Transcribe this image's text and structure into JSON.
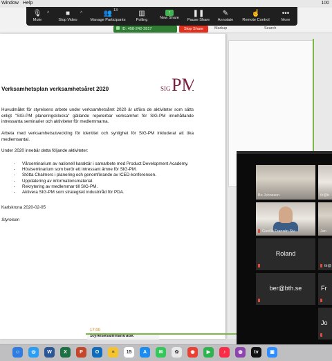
{
  "menubar": {
    "item_window": "Window",
    "item_help": "Help",
    "battery": "100"
  },
  "toolbar": {
    "mute": "Mute",
    "stop_video": "Stop Video",
    "manage_participants": "Manage Participants",
    "participant_count": "13",
    "polling": "Polling",
    "new_share": "New Share",
    "pause_share": "Pause Share",
    "annotate": "Annotate",
    "remote_control": "Remote Control",
    "more": "More"
  },
  "meeting": {
    "id_label": "ID: 458-242-2817",
    "stop_share": "Stop Share"
  },
  "app_labels": {
    "markup": "Markup",
    "search": "Search"
  },
  "document": {
    "logo_text": "SIG",
    "logo_letters": "PM",
    "title": "Verksamhetsplan verksamhetsåret 2020",
    "para1": "Huvudmålet för styrelsens arbete under verksamhetsåret 2020 är utföra de aktiviteter som sätts enligt \"SIG-PM planeringsklocka\" gällande repeterbar verksamhet för SIG-PM innehållande intressanta seminarier och aktiviteter för medlemmarna.",
    "para2": "Arbeta med verksamhetsutveckling för identitet och synlighet för SIG-PM inkluderat att öka medlemsantal.",
    "para3": "Under 2020 innebär detta följande aktiviteter:",
    "bullets": [
      "Vårseminarium av nationell karaktär i samarbete med Product Development Academy.",
      "Höstseminarium som berör ett intressant ämne för SIG-PM.",
      "Stötta Chalmers i planering och genomförande av ICED-konferensen.",
      "Uppdatering av informationsmaterial.",
      "Rekrytering av medlemmar till SIG-PM.",
      "Aktivera SIG-PM som strategiskt industriråd för PDA."
    ],
    "place_date": "Karlskrona 2020-02-05",
    "signature": "Styrelsen"
  },
  "memo": {
    "time": "17:00",
    "text": "Styrelsesammanträde:"
  },
  "participants": [
    {
      "name": "Bo Johnsson"
    },
    {
      "name": "tlr@b"
    },
    {
      "name": "Gunilla Franzén Siv..."
    },
    {
      "name": "Jan"
    },
    {
      "name": "Roland"
    },
    {
      "name": "tlr@"
    },
    {
      "name": "ber@bth.se"
    },
    {
      "name": "Fr"
    },
    {
      "name": "Jo"
    }
  ],
  "dock": {
    "icons": [
      {
        "name": "finder",
        "color": "#2f7de1",
        "glyph": "☺"
      },
      {
        "name": "safari",
        "color": "#2a9df4",
        "glyph": "◎"
      },
      {
        "name": "word",
        "color": "#2b5797",
        "glyph": "W"
      },
      {
        "name": "excel",
        "color": "#1d7044",
        "glyph": "X"
      },
      {
        "name": "powerpoint",
        "color": "#c4472b",
        "glyph": "P"
      },
      {
        "name": "outlook",
        "color": "#0f6cbd",
        "glyph": "O"
      },
      {
        "name": "notes",
        "color": "#f4c430",
        "glyph": "≡"
      },
      {
        "name": "calendar",
        "color": "#ffffff",
        "glyph": "15"
      },
      {
        "name": "app-store",
        "color": "#1c8cf0",
        "glyph": "A"
      },
      {
        "name": "messages",
        "color": "#34c759",
        "glyph": "✉"
      },
      {
        "name": "photos",
        "color": "#e9e9e9",
        "glyph": "✿"
      },
      {
        "name": "chrome",
        "color": "#e94235",
        "glyph": "◉"
      },
      {
        "name": "facetime",
        "color": "#2fb34f",
        "glyph": "▶"
      },
      {
        "name": "music",
        "color": "#fa2d48",
        "glyph": "♪"
      },
      {
        "name": "podcasts",
        "color": "#8e44ad",
        "glyph": "◍"
      },
      {
        "name": "tv",
        "color": "#111111",
        "glyph": "tv"
      },
      {
        "name": "zoom",
        "color": "#2d8cff",
        "glyph": "▣"
      }
    ]
  }
}
